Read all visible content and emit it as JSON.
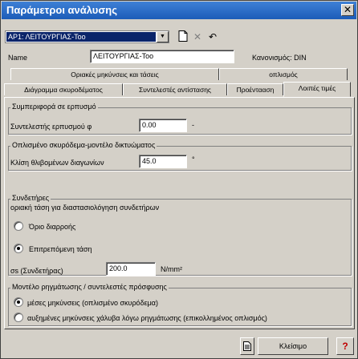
{
  "window": {
    "title": "Παράμετροι ανάλυσης",
    "close_glyph": "✕"
  },
  "toolbar": {
    "combo_value": "ΑΡ1: ΛΕΙΤΟΥΡΓΙΑΣ-Τοο",
    "icons": [
      "new-document-icon",
      "delete-icon",
      "undo-icon"
    ]
  },
  "name_row": {
    "label": "Name",
    "value": "ΛΕΙΤΟΥΡΓΙΑΣ-Τοο",
    "code_label": "Κανονισμός: DIN"
  },
  "tabs_top": [
    "Οριακές μηκύνσεις και τάσεις",
    "οπλισμός"
  ],
  "tabs_bottom": [
    "Διάγραμμα σκυροδέματος",
    "Συντελεστές αντίστασης",
    "Προέντααση",
    "Λοιπές τιμές"
  ],
  "creep": {
    "title": "Συμπεριφορά σε ερπυσμό",
    "label": "Συντελεστής ερπυσμού φ",
    "value": "0.00",
    "suffix": "-"
  },
  "truss": {
    "title": "Οπλισμένο σκυρόδεμα-μοντέλο δικτυώματος",
    "label": "Κλίση θλιβομένων διαγωνίων",
    "value": "45.0",
    "suffix": "°"
  },
  "stirrups": {
    "title": "Συνδετήρες",
    "subtitle": "οριακή τάση για διαστασιολόγηση συνδετήρων",
    "option1": "Όριο διαρροής",
    "option2": "Επιτρεπόμενη τάση",
    "sigma_label": "σs (Συνδετήρας)",
    "sigma_value": "200.0",
    "sigma_unit": "N/mm²"
  },
  "cracking": {
    "title": "Μοντέλο ρηγμάτωσης / συντελεστές πρόσφυσης",
    "option1": "μέσες μηκύνσεις (οπλισμένο σκυρόδεμα)",
    "option2": "αυξημένες μηκύνσεις χάλυβα λόγω ρηγμάτωσης (επικολλημένος οπλισμός)"
  },
  "footer": {
    "close_label": "Κλείσιμο",
    "help_glyph": "?"
  }
}
